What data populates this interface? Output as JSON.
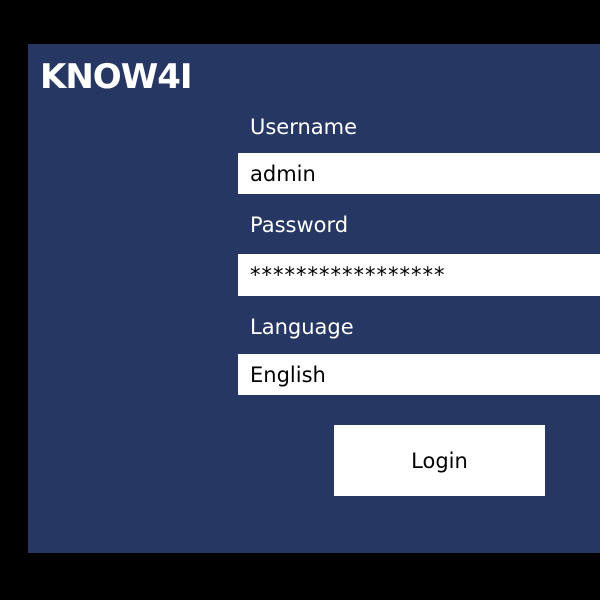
{
  "brand": {
    "name": "KNOW4I"
  },
  "form": {
    "username": {
      "label": "Username",
      "value": "admin"
    },
    "password": {
      "label": "Password",
      "value": "*****************"
    },
    "language": {
      "label": "Language",
      "value": "English"
    },
    "login_label": "Login"
  },
  "colors": {
    "background": "#000000",
    "panel": "#253762",
    "field": "#ffffff",
    "text_on_panel": "#ffffff"
  }
}
